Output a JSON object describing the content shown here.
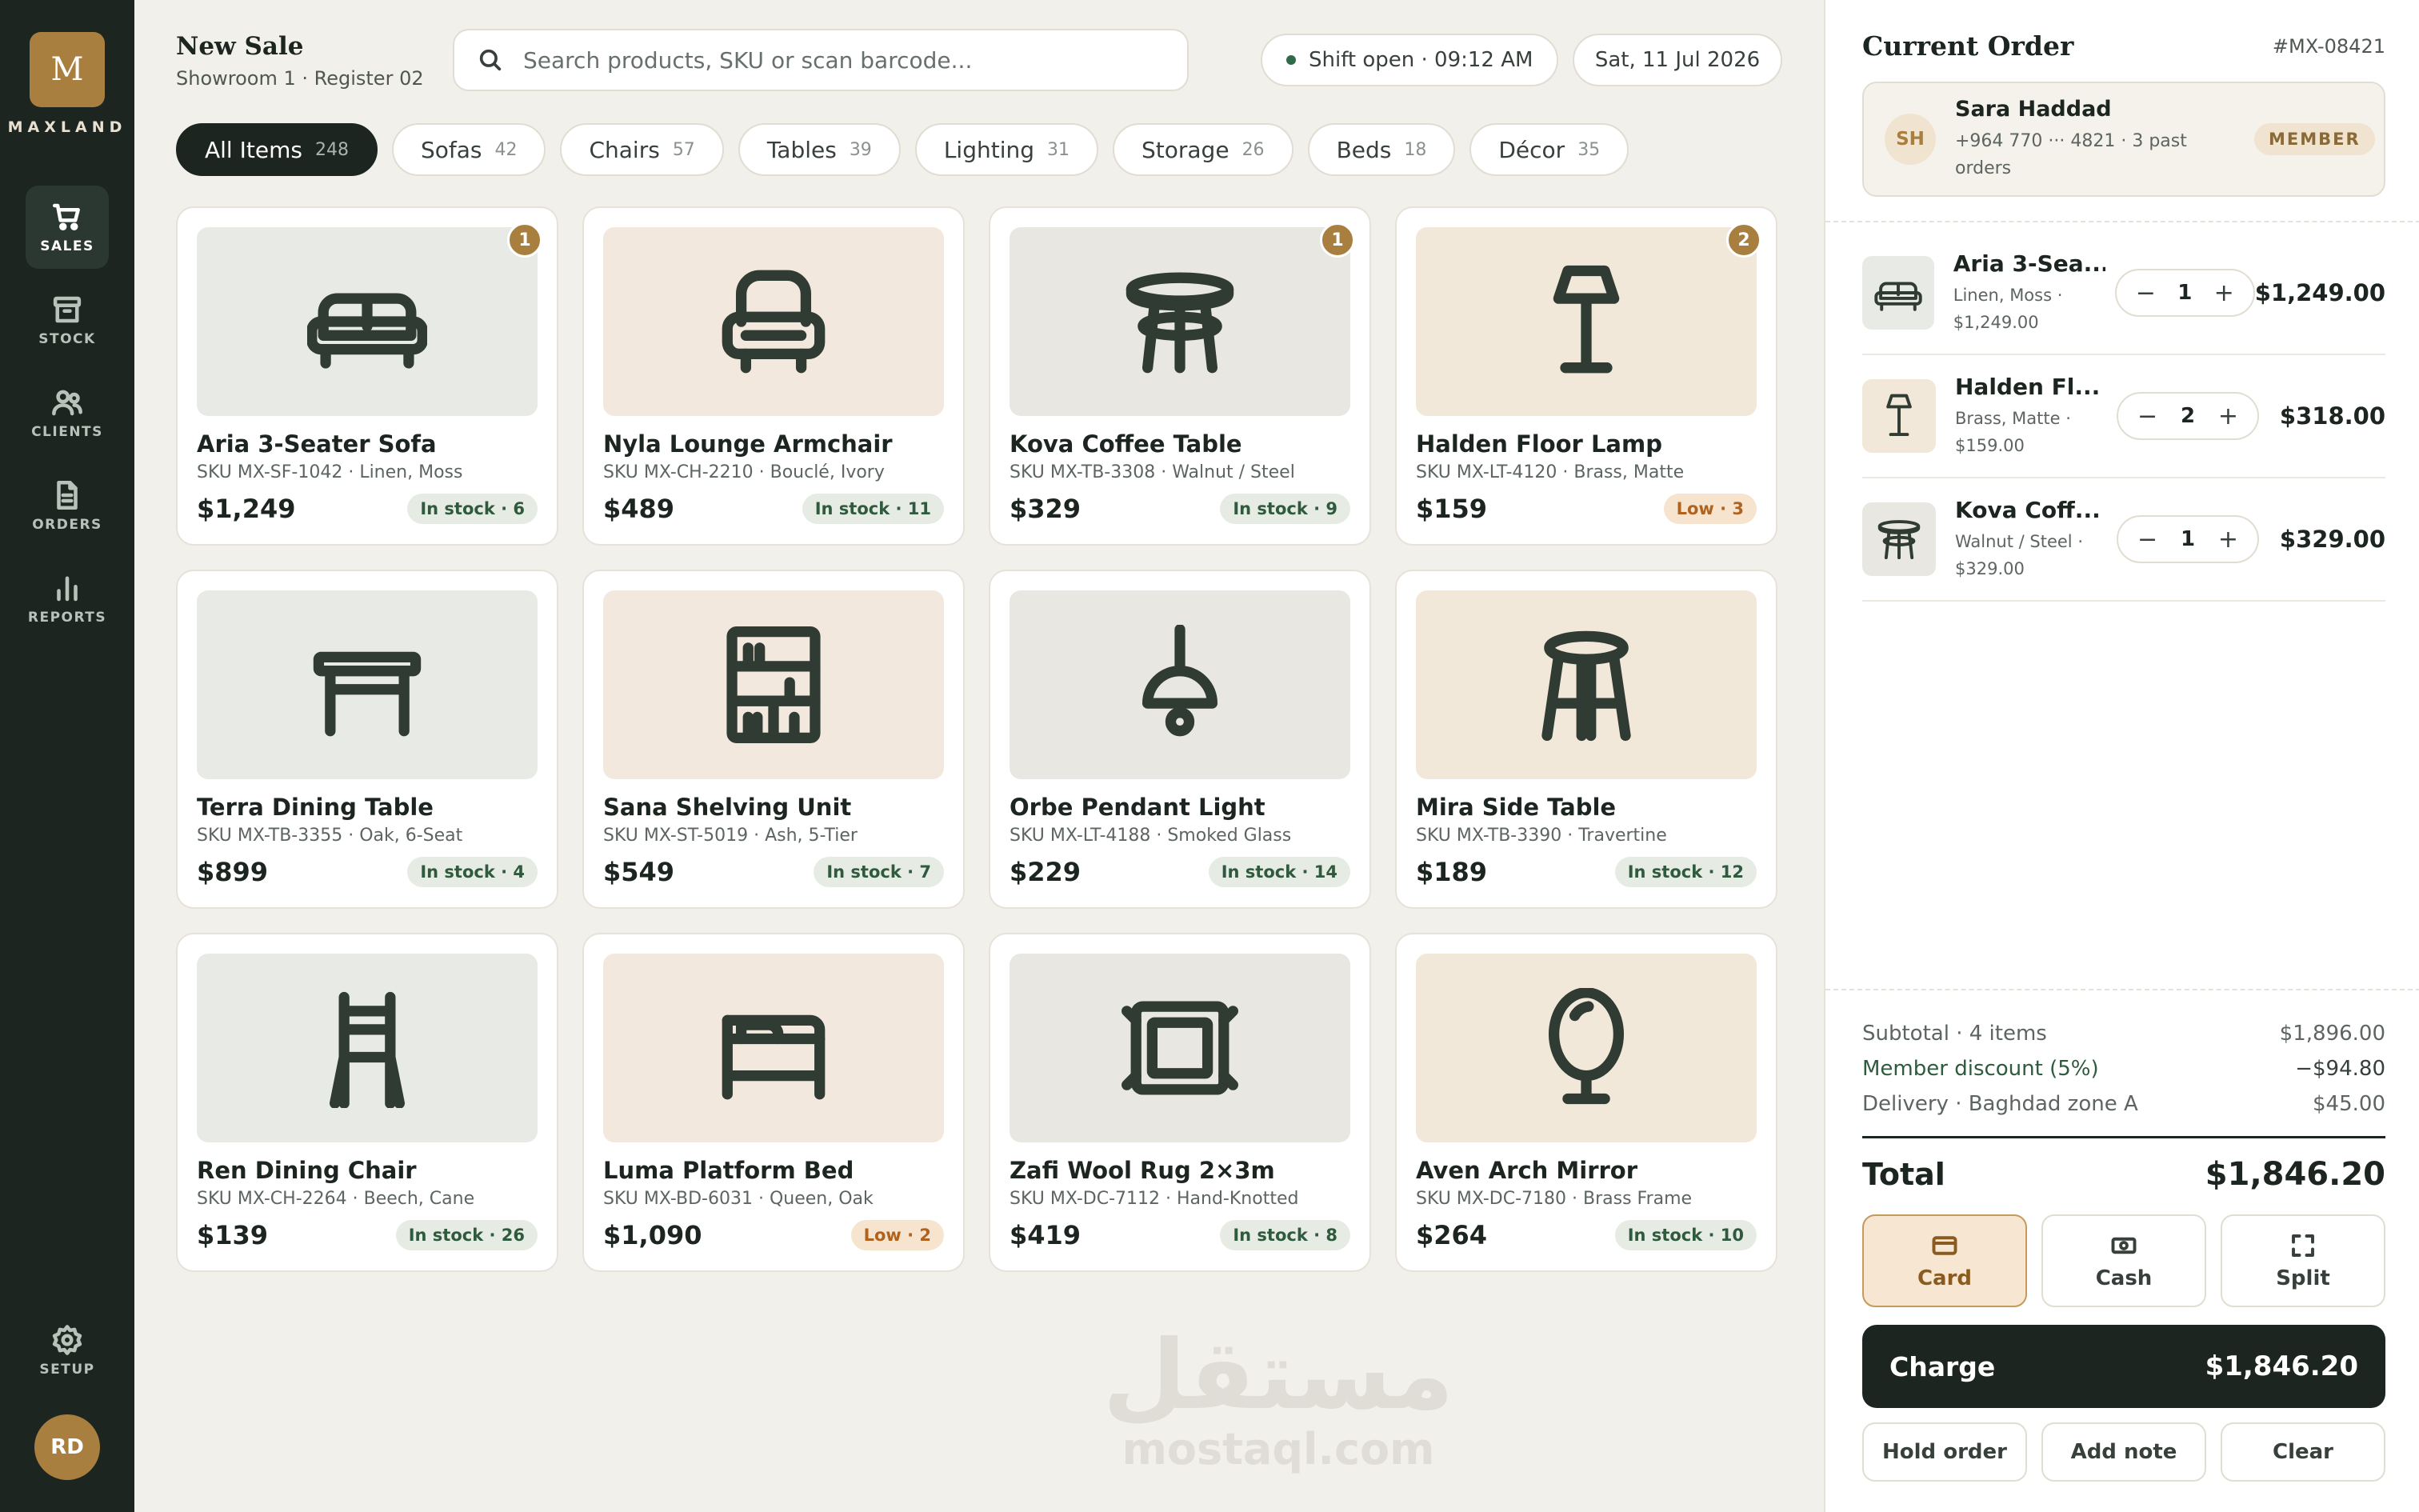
{
  "brand": {
    "initial": "M",
    "name": "MAXLAND",
    "accent": "#a97f3f",
    "dark": "#1c2520"
  },
  "nav": {
    "items": [
      {
        "label": "SALES",
        "icon": "cart-icon",
        "active": true
      },
      {
        "label": "STOCK",
        "icon": "box-icon"
      },
      {
        "label": "CLIENTS",
        "icon": "users-icon"
      },
      {
        "label": "ORDERS",
        "icon": "document-icon"
      },
      {
        "label": "REPORTS",
        "icon": "bar-chart-icon"
      }
    ],
    "setup_label": "SETUP",
    "user_initials": "RD"
  },
  "header": {
    "title": "New Sale",
    "subtitle": "Showroom 1 · Register 02",
    "search_placeholder": "Search products, SKU or scan barcode...",
    "shift": "Shift open · 09:12 AM",
    "date": "Sat, 11 Jul 2026"
  },
  "categories": [
    {
      "label": "All Items",
      "count": "248",
      "active": true
    },
    {
      "label": "Sofas",
      "count": "42"
    },
    {
      "label": "Chairs",
      "count": "57"
    },
    {
      "label": "Tables",
      "count": "39"
    },
    {
      "label": "Lighting",
      "count": "31"
    },
    {
      "label": "Storage",
      "count": "26"
    },
    {
      "label": "Beds",
      "count": "18"
    },
    {
      "label": "Décor",
      "count": "35"
    }
  ],
  "products": [
    {
      "name": "Aria 3-Seater Sofa",
      "sku": "SKU MX-SF-1042 · Linen, Moss",
      "price": "$1,249",
      "stock": "In stock · 6",
      "stock_level": "ok",
      "in_cart": "1",
      "icon": "sofa-icon",
      "bg": "#e8ebe5"
    },
    {
      "name": "Nyla Lounge Armchair",
      "sku": "SKU MX-CH-2210 · Bouclé, Ivory",
      "price": "$489",
      "stock": "In stock · 11",
      "stock_level": "ok",
      "in_cart": "",
      "icon": "armchair-icon",
      "bg": "#f2e8dd"
    },
    {
      "name": "Kova Coffee Table",
      "sku": "SKU MX-TB-3308 · Walnut / Steel",
      "price": "$329",
      "stock": "In stock · 9",
      "stock_level": "ok",
      "in_cart": "1",
      "icon": "coffee-table-icon",
      "bg": "#e9e7e2"
    },
    {
      "name": "Halden Floor Lamp",
      "sku": "SKU MX-LT-4120 · Brass, Matte",
      "price": "$159",
      "stock": "Low · 3",
      "stock_level": "low",
      "in_cart": "2",
      "icon": "floor-lamp-icon",
      "bg": "#f1e8d9"
    },
    {
      "name": "Terra Dining Table",
      "sku": "SKU MX-TB-3355 · Oak, 6-Seat",
      "price": "$899",
      "stock": "In stock · 4",
      "stock_level": "ok",
      "in_cart": "",
      "icon": "dining-table-icon",
      "bg": "#e8ebe5"
    },
    {
      "name": "Sana Shelving Unit",
      "sku": "SKU MX-ST-5019 · Ash, 5-Tier",
      "price": "$549",
      "stock": "In stock · 7",
      "stock_level": "ok",
      "in_cart": "",
      "icon": "shelving-icon",
      "bg": "#f2e8dd"
    },
    {
      "name": "Orbe Pendant Light",
      "sku": "SKU MX-LT-4188 · Smoked Glass",
      "price": "$229",
      "stock": "In stock · 14",
      "stock_level": "ok",
      "in_cart": "",
      "icon": "pendant-light-icon",
      "bg": "#e9e7e2"
    },
    {
      "name": "Mira Side Table",
      "sku": "SKU MX-TB-3390 · Travertine",
      "price": "$189",
      "stock": "In stock · 12",
      "stock_level": "ok",
      "in_cart": "",
      "icon": "side-table-icon",
      "bg": "#f1e8d9"
    },
    {
      "name": "Ren Dining Chair",
      "sku": "SKU MX-CH-2264 · Beech, Cane",
      "price": "$139",
      "stock": "In stock · 26",
      "stock_level": "ok",
      "in_cart": "",
      "icon": "chair-icon",
      "bg": "#e8ebe5"
    },
    {
      "name": "Luma Platform Bed",
      "sku": "SKU MX-BD-6031 · Queen, Oak",
      "price": "$1,090",
      "stock": "Low · 2",
      "stock_level": "low",
      "in_cart": "",
      "icon": "bed-icon",
      "bg": "#f2e8dd"
    },
    {
      "name": "Zafi Wool Rug 2×3m",
      "sku": "SKU MX-DC-7112 · Hand-Knotted",
      "price": "$419",
      "stock": "In stock · 8",
      "stock_level": "ok",
      "in_cart": "",
      "icon": "rug-icon",
      "bg": "#e9e7e2"
    },
    {
      "name": "Aven Arch Mirror",
      "sku": "SKU MX-DC-7180 · Brass Frame",
      "price": "$264",
      "stock": "In stock · 10",
      "stock_level": "ok",
      "in_cart": "",
      "icon": "mirror-icon",
      "bg": "#f1e8d9"
    }
  ],
  "watermark": {
    "arabic": "مستقل",
    "latin": "mostaql.com"
  },
  "order": {
    "title": "Current Order",
    "id": "#MX-08421",
    "client": {
      "initials": "SH",
      "name": "Sara Haddad",
      "details": "+964 770 ··· 4821 · 3 past orders",
      "badge": "MEMBER"
    },
    "lines": [
      {
        "name": "Aria 3-Sea...",
        "variant": "Linen, Moss · $1,249.00",
        "qty": "1",
        "total": "$1,249.00",
        "icon": "sofa-icon",
        "bg": "#e8ebe5"
      },
      {
        "name": "Halden Fl...",
        "variant": "Brass, Matte · $159.00",
        "qty": "2",
        "total": "$318.00",
        "icon": "floor-lamp-icon",
        "bg": "#f1e8d9"
      },
      {
        "name": "Kova Coff...",
        "variant": "Walnut / Steel · $329.00",
        "qty": "1",
        "total": "$329.00",
        "icon": "coffee-table-icon",
        "bg": "#e9e7e2"
      }
    ],
    "summary": {
      "subtotal_label": "Subtotal · 4 items",
      "subtotal": "$1,896.00",
      "discount_label": "Member discount (5%)",
      "discount": "−$94.80",
      "delivery_label": "Delivery · Baghdad zone A",
      "delivery": "$45.00",
      "total_label": "Total",
      "total": "$1,846.20"
    },
    "payment_methods": [
      {
        "label": "Card",
        "icon": "card-icon",
        "active": true
      },
      {
        "label": "Cash",
        "icon": "cash-icon"
      },
      {
        "label": "Split",
        "icon": "split-icon"
      }
    ],
    "charge_label": "Charge",
    "charge_amount": "$1,846.20",
    "actions": [
      "Hold order",
      "Add note",
      "Clear"
    ]
  }
}
